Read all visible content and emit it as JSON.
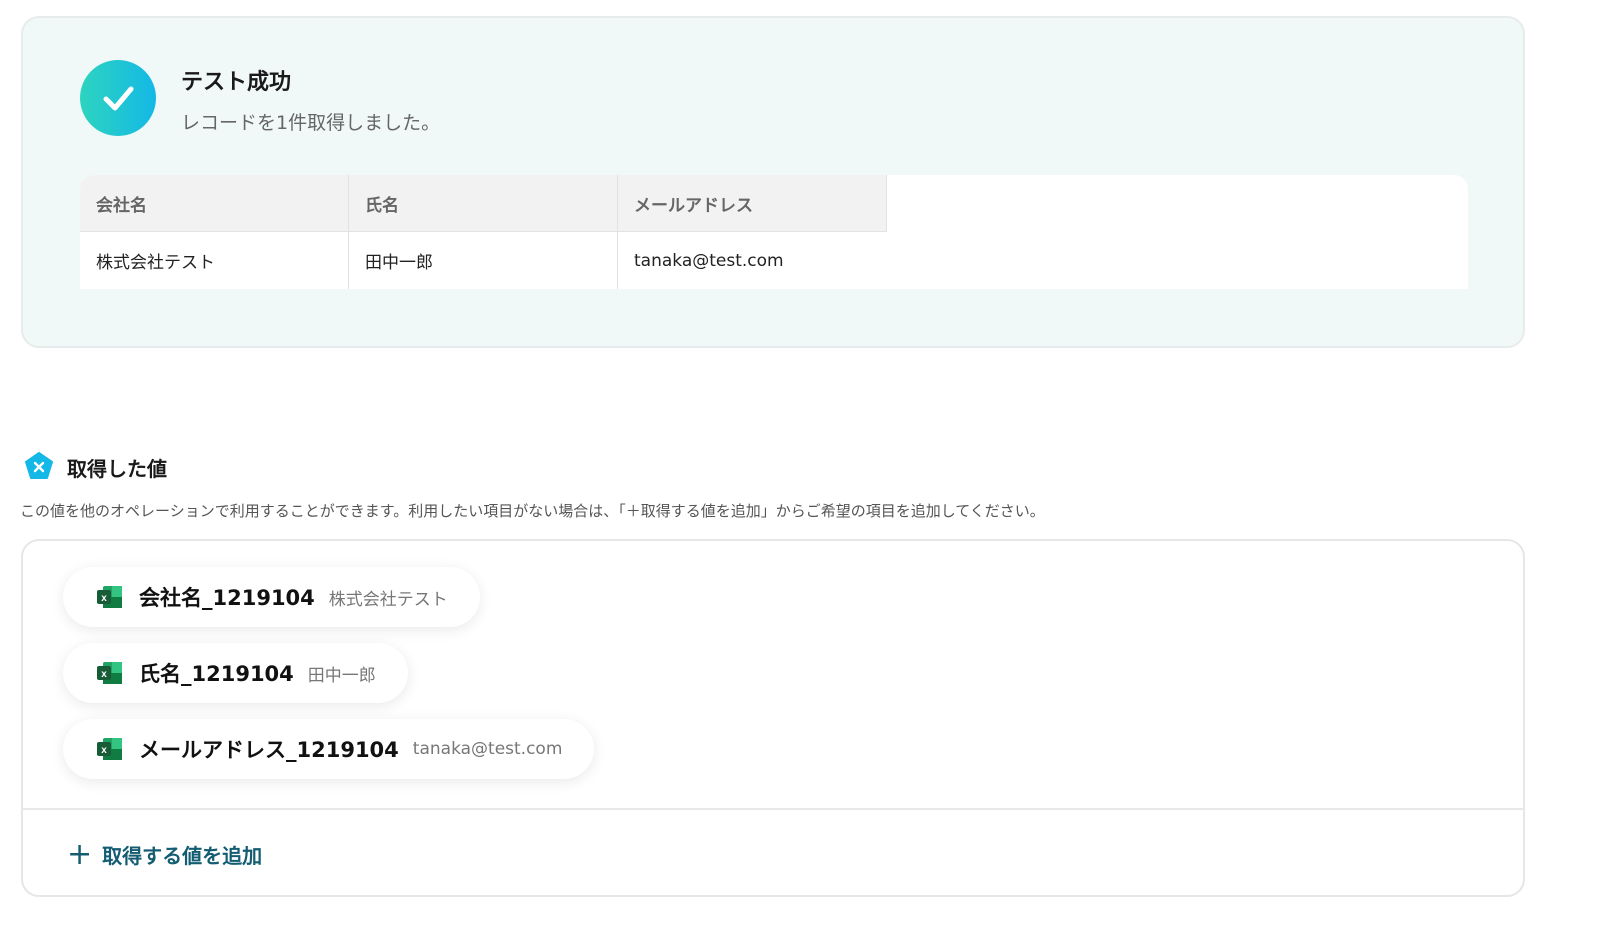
{
  "success": {
    "title": "テスト成功",
    "subtitle": "レコードを1件取得しました。",
    "table": {
      "headers": [
        "会社名",
        "氏名",
        "メールアドレス"
      ],
      "rows": [
        [
          "株式会社テスト",
          "田中一郎",
          "tanaka@test.com"
        ]
      ]
    }
  },
  "values_section": {
    "title": "取得した値",
    "description": "この値を他のオペレーションで利用することができます。利用したい項目がない場合は、「＋取得する値を追加」からご希望の項目を追加してください。",
    "items": [
      {
        "name": "会社名_1219104",
        "value": "株式会社テスト"
      },
      {
        "name": "氏名_1219104",
        "value": "田中一郎"
      },
      {
        "name": "メールアドレス_1219104",
        "value": "tanaka@test.com"
      }
    ],
    "add_label": "取得する値を追加"
  },
  "colors": {
    "accent": "#135c72",
    "success": "#14b8e6",
    "excel": "#1d7044"
  }
}
